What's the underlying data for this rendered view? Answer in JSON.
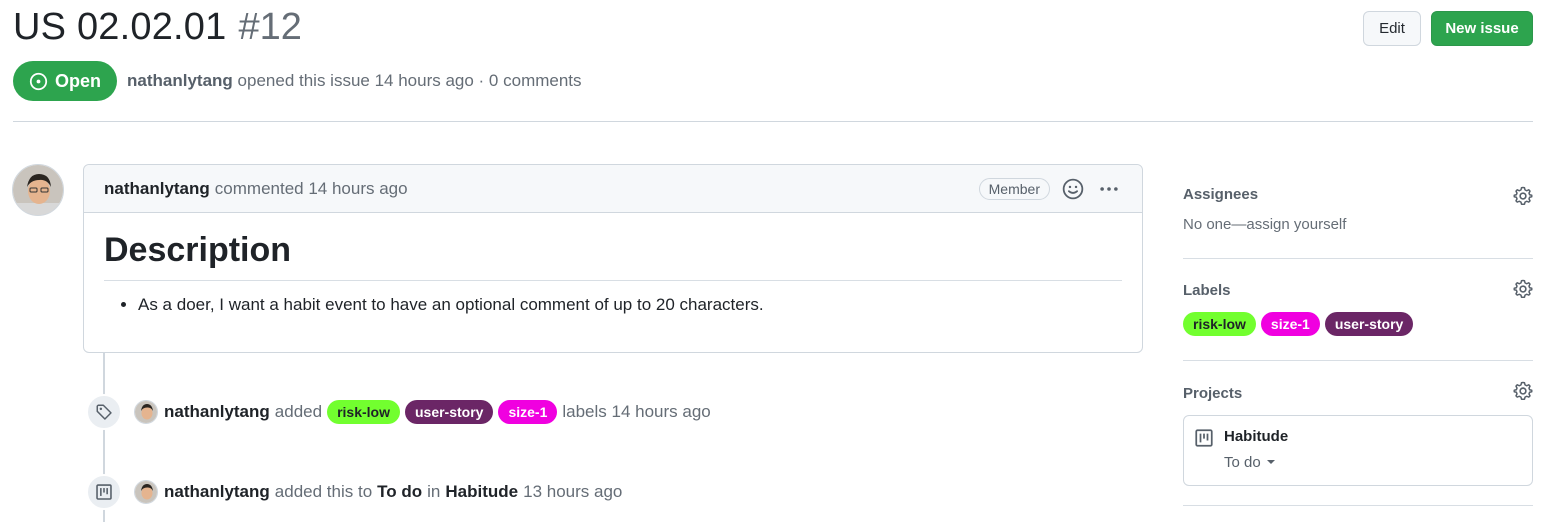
{
  "issue": {
    "title": "US 02.02.01",
    "number": "#12",
    "state": "Open",
    "author": "nathanlytang",
    "meta_text": "opened this issue 14 hours ago · 0 comments"
  },
  "header_buttons": {
    "edit": "Edit",
    "new_issue": "New issue"
  },
  "comment": {
    "author": "nathanlytang",
    "action": "commented 14 hours ago",
    "badge": "Member",
    "heading": "Description",
    "bullets": [
      "As a doer, I want a habit event to have an optional comment of up to 20 characters."
    ]
  },
  "labels": {
    "risk_low": {
      "name": "risk-low",
      "color": "#72ff2f"
    },
    "size_1": {
      "name": "size-1",
      "color": "#f000e0"
    },
    "user_story": {
      "name": "user-story",
      "color": "#6b2666"
    }
  },
  "timeline": [
    {
      "author": "nathanlytang",
      "verb": "added",
      "suffix": "labels 14 hours ago",
      "icon": "tag-icon"
    },
    {
      "author": "nathanlytang",
      "prefix": "added this to",
      "column": "To do",
      "in": "in",
      "project": "Habitude",
      "time": "13 hours ago",
      "icon": "project-icon"
    }
  ],
  "sidebar": {
    "assignees": {
      "title": "Assignees",
      "value": "No one—assign yourself"
    },
    "labels": {
      "title": "Labels"
    },
    "projects": {
      "title": "Projects",
      "project_name": "Habitude",
      "column": "To do"
    }
  },
  "colors": {
    "open_green": "#2da44e",
    "muted": "#656d76",
    "border": "#d0d7de"
  }
}
